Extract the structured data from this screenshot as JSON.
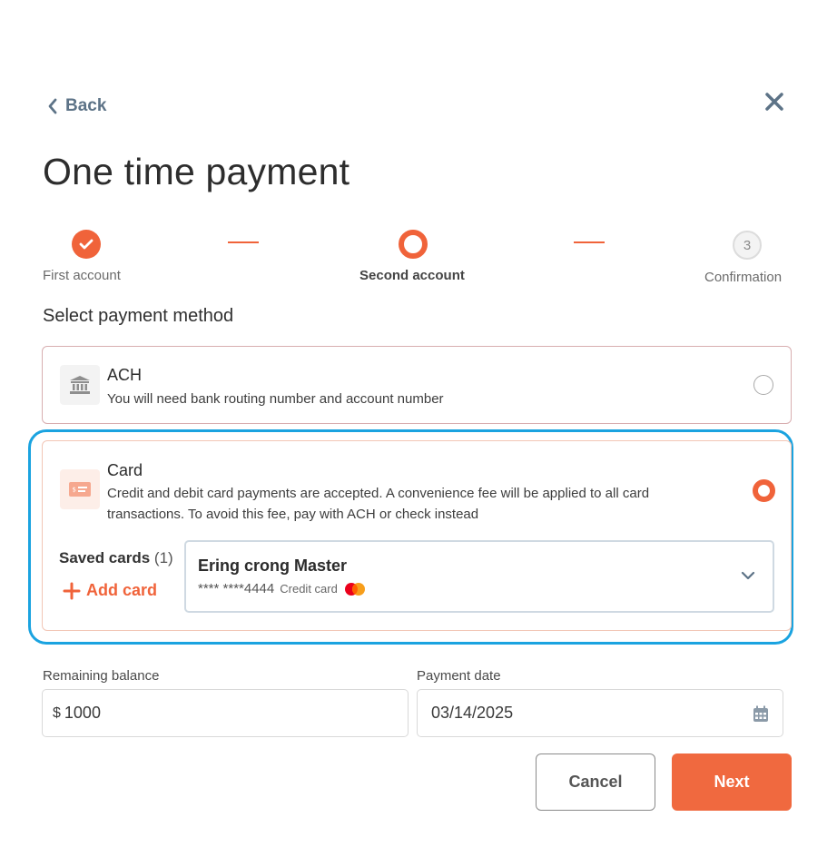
{
  "header": {
    "back_label": "Back",
    "title": "One time payment"
  },
  "steps": [
    {
      "label": "First account",
      "state": "done"
    },
    {
      "label": "Second account",
      "state": "current"
    },
    {
      "label": "Confirmation",
      "state": "todo",
      "number": "3"
    }
  ],
  "payment": {
    "section_title": "Select payment method",
    "ach": {
      "title": "ACH",
      "description": "You will need bank routing number and account number",
      "selected": false
    },
    "card": {
      "title": "Card",
      "description_line1": "Credit and debit card payments are accepted. A  convenience fee will be applied to all card",
      "description_line2": "transactions. To avoid this fee, pay with ACH or check instead",
      "selected": true,
      "saved_cards_label": "Saved cards",
      "saved_cards_count": "(1)",
      "add_card_label": "Add card",
      "selected_card": {
        "name": "Ering crong Master",
        "masked_number": "**** ****4444",
        "type": "Credit card",
        "brand_icon": "mastercard-icon"
      }
    }
  },
  "form": {
    "remaining_balance_label": "Remaining balance",
    "currency_symbol": "$",
    "remaining_balance_value": "1000",
    "payment_date_label": "Payment date",
    "payment_date_value": "03/14/2025"
  },
  "actions": {
    "cancel_label": "Cancel",
    "next_label": "Next"
  },
  "colors": {
    "accent": "#f0633a",
    "focus_ring": "#1aa3e0",
    "back_link": "#5d7387"
  }
}
